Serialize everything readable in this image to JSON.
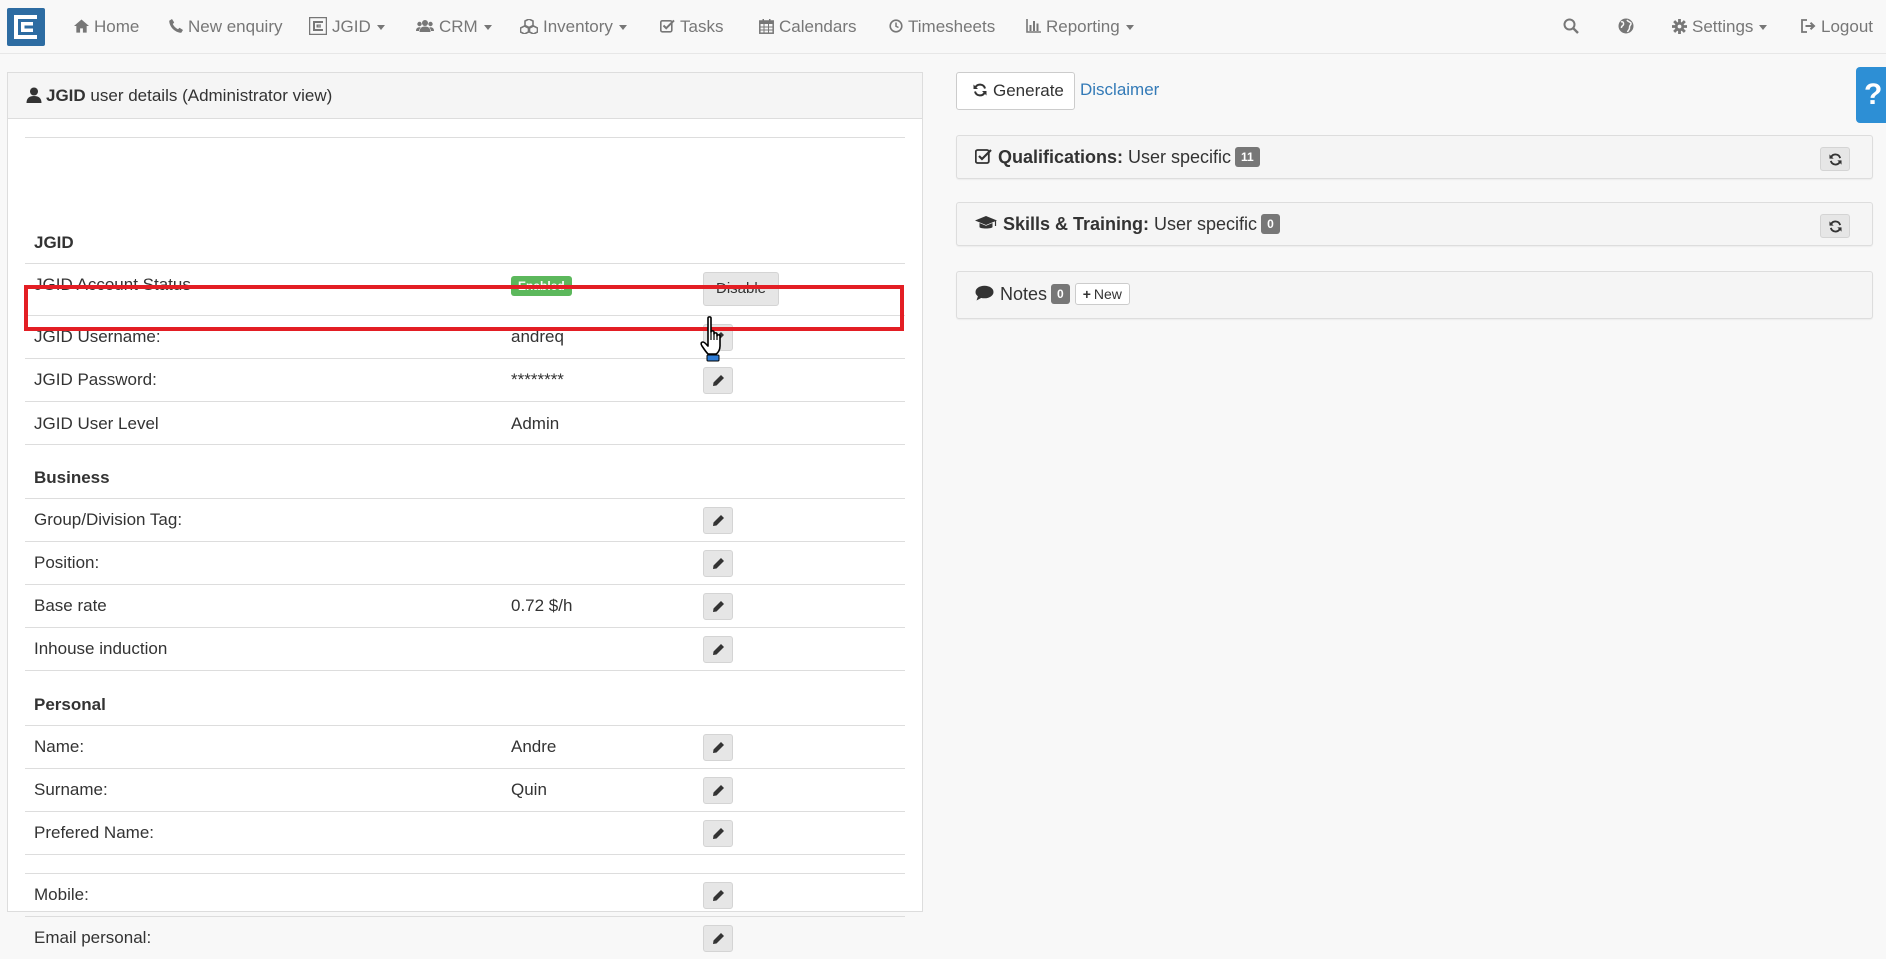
{
  "nav": {
    "home": "Home",
    "new_enquiry": "New enquiry",
    "jgid": "JGID",
    "crm": "CRM",
    "inventory": "Inventory",
    "tasks": "Tasks",
    "calendars": "Calendars",
    "timesheets": "Timesheets",
    "reporting": "Reporting",
    "settings": "Settings",
    "logout": "Logout"
  },
  "panel": {
    "title_bold": "JGID",
    "title_rest": " user details (Administrator view)"
  },
  "sections": {
    "jgid": "JGID",
    "business": "Business",
    "personal": "Personal"
  },
  "rows": {
    "account_status": {
      "label": "JGID Account Status",
      "badge": "Enabled",
      "action": "Disable"
    },
    "username": {
      "label": "JGID Username:",
      "value": "andreq"
    },
    "password": {
      "label": "JGID Password:",
      "value": "********"
    },
    "user_level": {
      "label": "JGID User Level",
      "value": "Admin"
    },
    "group_tag": {
      "label": "Group/Division Tag:",
      "value": ""
    },
    "position": {
      "label": "Position:",
      "value": ""
    },
    "base_rate": {
      "label": "Base rate",
      "value": "0.72 $/h"
    },
    "induction": {
      "label": "Inhouse induction",
      "value": ""
    },
    "name": {
      "label": "Name:",
      "value": "Andre"
    },
    "surname": {
      "label": "Surname:",
      "value": "Quin"
    },
    "prefered_name": {
      "label": "Prefered Name:",
      "value": ""
    },
    "mobile": {
      "label": "Mobile:",
      "value": ""
    },
    "email_personal": {
      "label": "Email personal:",
      "value": ""
    }
  },
  "right": {
    "generate": "Generate",
    "disclaimer": "Disclaimer",
    "qualifications": {
      "title_bold": "Qualifications:",
      "subtitle": " User specific",
      "count": "11"
    },
    "skills": {
      "title_bold": "Skills & Training:",
      "subtitle": " User specific",
      "count": "0"
    },
    "notes": {
      "title": "Notes",
      "count": "0",
      "new_label": "New"
    }
  },
  "help": "?",
  "colors": {
    "highlight": "#e31e24",
    "enabled": "#5cb85c",
    "link": "#337ab7",
    "brand": "#2d6ca2"
  }
}
